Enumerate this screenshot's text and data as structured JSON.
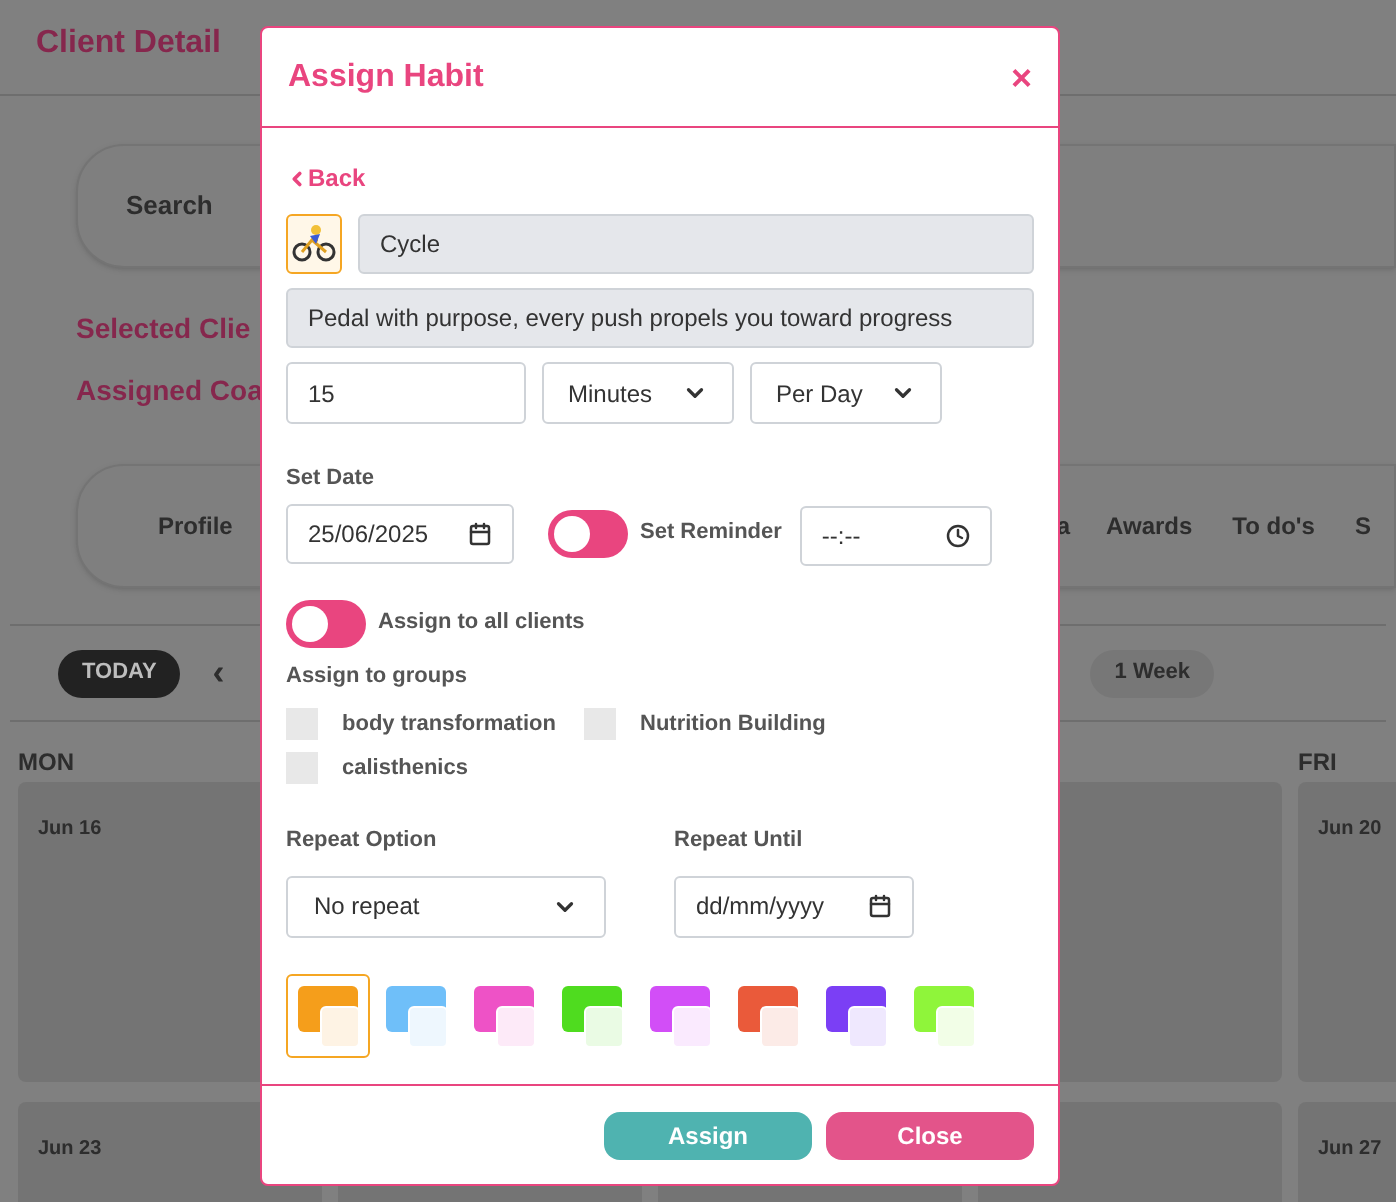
{
  "page": {
    "title": "Client Detail",
    "search_label": "Search",
    "selected_client": "Selected Clie",
    "assigned_coach": "Assigned Coa",
    "tabs": [
      {
        "label": "Profile"
      },
      {
        "label": "a"
      },
      {
        "label": "Awards"
      },
      {
        "label": "To do's"
      },
      {
        "label": "S"
      }
    ],
    "toolbar": {
      "today": "TODAY",
      "prev": "‹",
      "range": "1 Week"
    },
    "calendar": {
      "columns": [
        {
          "day": "MON"
        },
        {},
        {},
        {},
        {
          "day": "FRI"
        }
      ],
      "rows": [
        {
          "cells": [
            {
              "date": "Jun 16"
            },
            {},
            {},
            {},
            {
              "date": "Jun 20"
            }
          ]
        },
        {
          "cells": [
            {
              "date": "Jun 23"
            },
            {},
            {},
            {},
            {
              "date": "Jun 27"
            }
          ]
        }
      ]
    }
  },
  "dialog": {
    "title": "Assign Habit",
    "close_icon": "×",
    "back": "Back",
    "habit_name": "Cycle",
    "habit_description": "Pedal with purpose, every push propels you toward progress",
    "amount": "15",
    "unit": "Minutes",
    "frequency": "Per Day",
    "set_date_label": "Set Date",
    "date": "25/06/2025",
    "reminder": {
      "label": "Set Reminder",
      "on": false,
      "time": "--:--"
    },
    "assign_all": {
      "label": "Assign to all clients",
      "on": false
    },
    "groups_label": "Assign to groups",
    "groups": [
      {
        "label": "body transformation",
        "checked": false
      },
      {
        "label": "Nutrition Building",
        "checked": false
      },
      {
        "label": "calisthenics",
        "checked": false
      }
    ],
    "repeat_label": "Repeat Option",
    "repeat": "No repeat",
    "repeat_until_label": "Repeat Until",
    "repeat_until": "dd/mm/yyyy",
    "colors": [
      {
        "color": "#f59e1b",
        "selected": true
      },
      {
        "color": "#6fbff9",
        "selected": false
      },
      {
        "color": "#ee52c6",
        "selected": false
      },
      {
        "color": "#4fdc1f",
        "selected": false
      },
      {
        "color": "#d24ef7",
        "selected": false
      },
      {
        "color": "#ea5a3a",
        "selected": false
      },
      {
        "color": "#7b3ff5",
        "selected": false
      },
      {
        "color": "#8ff53a",
        "selected": false
      }
    ],
    "buttons": [
      {
        "label": "Assign",
        "kind": "primary"
      },
      {
        "label": "Close",
        "kind": "secondary"
      }
    ]
  }
}
